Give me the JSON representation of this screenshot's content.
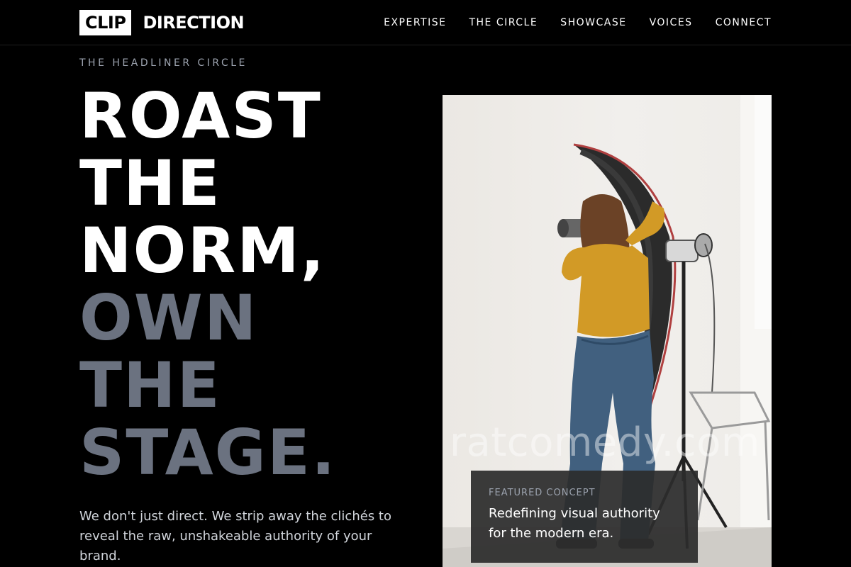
{
  "brand": {
    "mark": "CLIP",
    "name": "DIRECTION"
  },
  "nav": {
    "items": [
      {
        "label": "EXPERTISE"
      },
      {
        "label": "THE CIRCLE"
      },
      {
        "label": "SHOWCASE"
      },
      {
        "label": "VOICES"
      },
      {
        "label": "CONNECT"
      }
    ]
  },
  "hero": {
    "eyebrow": "THE HEADLINER CIRCLE",
    "headline_lines": [
      {
        "text": "ROAST",
        "style": "light"
      },
      {
        "text": "THE",
        "style": "light"
      },
      {
        "text": "NORM,",
        "style": "light"
      },
      {
        "text": "OWN",
        "style": "muted"
      },
      {
        "text": "THE",
        "style": "muted"
      },
      {
        "text": "STAGE.",
        "style": "muted"
      }
    ],
    "lead": "We don't just direct. We strip away the clichés to reveal the raw, unshakeable authority of your brand."
  },
  "media": {
    "watermark": "ratcomedy.com",
    "photo_subject": "photographer-with-studio-lights"
  },
  "featured": {
    "label": "FEATURED CONCEPT",
    "text": "Redefining visual authority for the modern era."
  },
  "colors": {
    "background": "#000000",
    "text": "#ffffff",
    "muted_heading": "#6b7280",
    "eyebrow": "#9ca3af",
    "card_bg": "#2c2c2c"
  }
}
